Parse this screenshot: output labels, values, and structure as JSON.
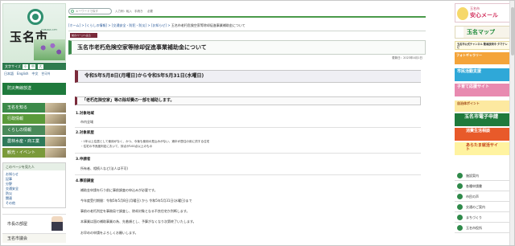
{
  "site": {
    "city_name": "玉名市",
    "logo_sub": "TAMANA CITY",
    "size_label": "文字サイズ",
    "size_buttons": [
      "小",
      "中",
      "大"
    ],
    "languages": "日本語　English　中文　한국어",
    "bousai": "防災無線放送"
  },
  "header": {
    "search_placeholder": "キーワードで探す",
    "links": [
      "入力例：転入",
      "手続き",
      "必要"
    ],
    "brand_color": "#3a8a4a"
  },
  "left_nav": [
    {
      "label": "玉名を知る"
    },
    {
      "label": "行政情報"
    },
    {
      "label": "くらしの情報"
    },
    {
      "label": "農林水産・商工業"
    },
    {
      "label": "観光・イベント"
    }
  ],
  "side_menu": {
    "head": "このページを見た人",
    "items": [
      "お知らせ",
      "記事",
      "分野",
      "交通安全",
      "防災",
      "関連",
      "その他"
    ]
  },
  "mayor": {
    "label": "市長の部屋"
  },
  "council": {
    "label": "玉名市議会"
  },
  "breadcrumb": {
    "items": [
      "ホーム",
      "くらしの情報",
      "交通安全・防犯・防災",
      "お知らせ"
    ],
    "current": "玉名市老朽危険空家等除却促進事業補助金について"
  },
  "tab_label": "前のページへ戻る",
  "page_title": "玉名市老朽危険空家等除却促進事業補助金について",
  "updated": "更新日：2023年4月1日",
  "period": "令和5年5月8日(月曜日)から令和5年5月31日(水曜日)",
  "subsidy_heading": "「老朽危険空家」等の除却費の一部を補助します。",
  "sections": {
    "s1_head": "1.対象地域",
    "s1_text": "市内全域",
    "s2_head": "2.対象家屋",
    "s2_bullets": [
      "1年以上住居として使用がなく、かつ、今後も使用の見込みがない、適半が居住の用に供する住宅",
      "住宅の不良度判定において、評点が100点以上のもの"
    ],
    "s3_head": "3.申請者",
    "s3_text": "所有者、相続人など(法人は不可)",
    "s4_head": "4.事前調査",
    "s4_lines": [
      "補助金申請を行う前に事前調査の申込みが必要です。",
      "今年度受付期間：令和5年5月8日(月曜日) から 令和5年5月31日(水曜日)まで",
      "事前の老朽判定を事務局で調査し、除却対象となる不良住宅か判断します。",
      "本事業は国の補助事業の為、先着順とし、予算がなくなり次第終了いたします。",
      "お早めの申請をよろしくお願いします。"
    ]
  },
  "right_col": {
    "anshin_small": "玉名市",
    "anshin_big": "安心メール",
    "banners": [
      "玉名マップ",
      "玉名市公式チャンネル 動画放映中 タマテレビ",
      "フォトギャラリー",
      "市民活動支援",
      "子育て応援サイト",
      "自治体ポイント",
      "玉名市電子申請",
      "消費生活相談",
      "あらたま就活サイト"
    ],
    "links": [
      "施設案内",
      "各種申請書",
      "市民の声",
      "交通のご案内",
      "まちづくり",
      "玉名市役所"
    ]
  }
}
